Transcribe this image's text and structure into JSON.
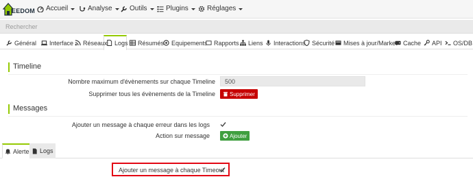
{
  "app": {
    "brand": "EEDOM"
  },
  "nav": {
    "items": [
      {
        "label": "Accueil",
        "icon": "dashboard-icon"
      },
      {
        "label": "Analyse",
        "icon": "stethoscope-icon"
      },
      {
        "label": "Outils",
        "icon": "wrench-icon"
      },
      {
        "label": "Plugins",
        "icon": "list-icon"
      },
      {
        "label": "Réglages",
        "icon": "gear-icon"
      }
    ]
  },
  "search": {
    "placeholder": "Rechercher"
  },
  "tabs": [
    {
      "label": "Général",
      "icon": "wrench-icon"
    },
    {
      "label": "Interface",
      "icon": "laptop-icon"
    },
    {
      "label": "Réseaux",
      "icon": "rss-icon"
    },
    {
      "label": "Logs",
      "icon": "file-icon"
    },
    {
      "label": "Résumés",
      "icon": "table-icon"
    },
    {
      "label": "Equipements",
      "icon": "gauge-icon"
    },
    {
      "label": "Rapports",
      "icon": "chart-icon"
    },
    {
      "label": "Liens",
      "icon": "sitemap-icon"
    },
    {
      "label": "Interactions",
      "icon": "microphone-icon"
    },
    {
      "label": "Sécurité",
      "icon": "shield-icon"
    },
    {
      "label": "Mises à jour/Market",
      "icon": "package-icon"
    },
    {
      "label": "Cache",
      "icon": "harddisk-icon"
    },
    {
      "label": "API",
      "icon": "key-icon"
    },
    {
      "label": "OS/DB",
      "icon": "terminal-icon"
    }
  ],
  "timeline": {
    "title": "Timeline",
    "max_events_label": "Nombre maximum d'évènements sur chaque Timeline",
    "max_events_value": "500",
    "delete_all_label": "Supprimer tous les évènements de la Timeline",
    "delete_button": "Supprimer"
  },
  "messages": {
    "title": "Messages",
    "error_log_label": "Ajouter un message à chaque erreur dans les logs",
    "action_label": "Action sur message",
    "add_button": "Ajouter"
  },
  "subtabs": [
    {
      "label": "Alertes",
      "icon": "bell-icon"
    },
    {
      "label": "Logs",
      "icon": "file-icon"
    }
  ],
  "alerts": {
    "timeout_label": "Ajouter un message à chaque Timeout"
  },
  "colors": {
    "accent": "#94ca02",
    "danger": "#c60000",
    "success": "#3f9f3f",
    "highlight": "#e30613"
  }
}
